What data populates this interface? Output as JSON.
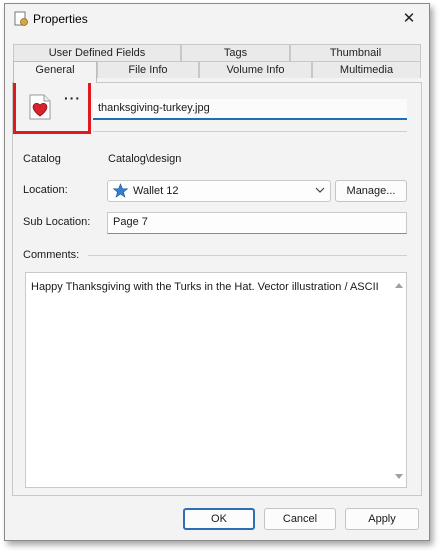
{
  "window": {
    "title": "Properties",
    "close_glyph": "✕"
  },
  "tabs": {
    "row1": [
      "User Defined Fields",
      "Tags",
      "Thumbnail"
    ],
    "row2": [
      "General",
      "File Info",
      "Volume Info",
      "Multimedia"
    ],
    "active": "General"
  },
  "general": {
    "more_label": "···",
    "filename": "thanksgiving-turkey.jpg",
    "catalog_label": "Catalog",
    "catalog_value": "Catalog\\design",
    "location_label": "Location:",
    "location_value": "Wallet 12",
    "location_icon": "star-icon",
    "manage_label": "Manage...",
    "sublocation_label": "Sub Location:",
    "sublocation_value": "Page 7",
    "comments_label": "Comments:",
    "comments_value": "Happy Thanksgiving with the Turks in the Hat. Vector illustration / ASCII"
  },
  "footer": {
    "ok": "OK",
    "cancel": "Cancel",
    "apply": "Apply"
  },
  "colors": {
    "highlight_box": "#e0191f",
    "accent": "#2a6fb8",
    "star": "#2f7fd6"
  }
}
